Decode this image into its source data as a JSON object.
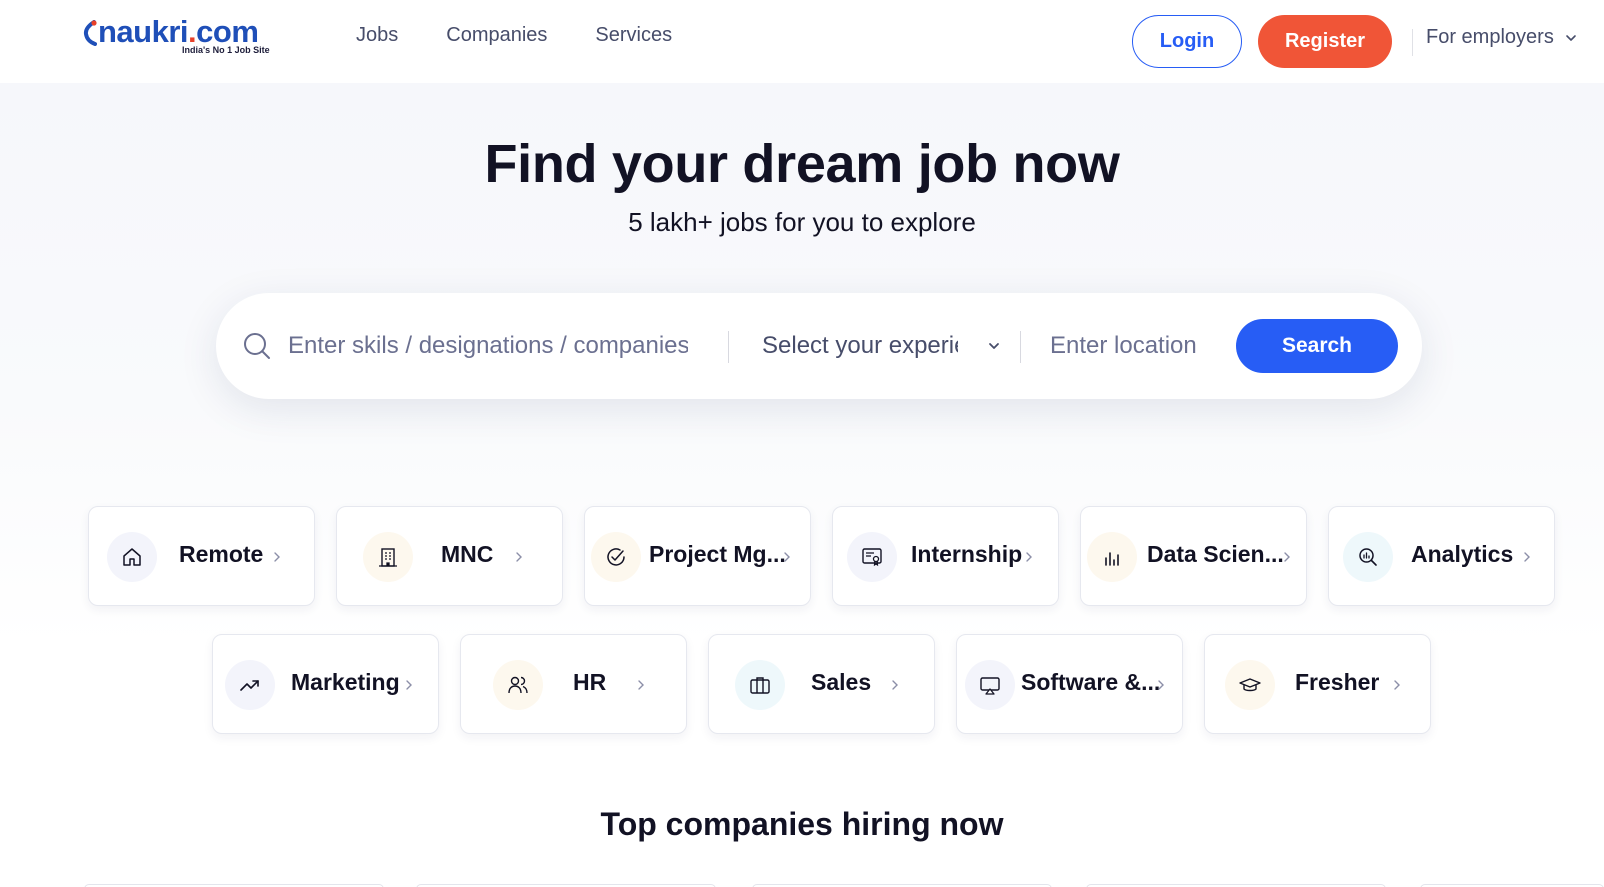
{
  "header": {
    "logo_text": "naukri",
    "logo_dot": ".",
    "logo_com": "com",
    "logo_tagline": "India's No 1 Job Site",
    "nav": [
      "Jobs",
      "Companies",
      "Services"
    ],
    "login_label": "Login",
    "register_label": "Register",
    "employers_label": "For employers"
  },
  "hero": {
    "title": "Find your dream job now",
    "subtitle": "5 lakh+ jobs for you to explore"
  },
  "search": {
    "skills_placeholder": "Enter skils / designations / companies",
    "experience_label": "Select your experience",
    "location_placeholder": "Enter location",
    "button_label": "Search"
  },
  "categories": {
    "row1": [
      {
        "label": "Remote",
        "icon": "home-icon",
        "bg": "#f3f4fb"
      },
      {
        "label": "MNC",
        "icon": "building-icon",
        "bg": "#fdf8ee"
      },
      {
        "label": "Project Mg...",
        "icon": "check-circle-icon",
        "bg": "#fdf8ee"
      },
      {
        "label": "Internship",
        "icon": "certificate-icon",
        "bg": "#f3f4fb"
      },
      {
        "label": "Data Scien...",
        "icon": "bar-chart-icon",
        "bg": "#fdf8ee"
      },
      {
        "label": "Analytics",
        "icon": "magnify-chart-icon",
        "bg": "#eef8fb"
      }
    ],
    "row2": [
      {
        "label": "Marketing",
        "icon": "trend-up-icon",
        "bg": "#f3f4fb"
      },
      {
        "label": "HR",
        "icon": "people-icon",
        "bg": "#fdf8ee"
      },
      {
        "label": "Sales",
        "icon": "briefcase-icon",
        "bg": "#eef8fb"
      },
      {
        "label": "Software &...",
        "icon": "monitor-icon",
        "bg": "#f3f4fb"
      },
      {
        "label": "Fresher",
        "icon": "graduation-cap-icon",
        "bg": "#fdf8ee"
      }
    ]
  },
  "sections": {
    "top_companies_title": "Top companies hiring now"
  },
  "colors": {
    "brand_blue": "#275df5",
    "register_orange": "#f05537",
    "text_dark": "#121224"
  }
}
